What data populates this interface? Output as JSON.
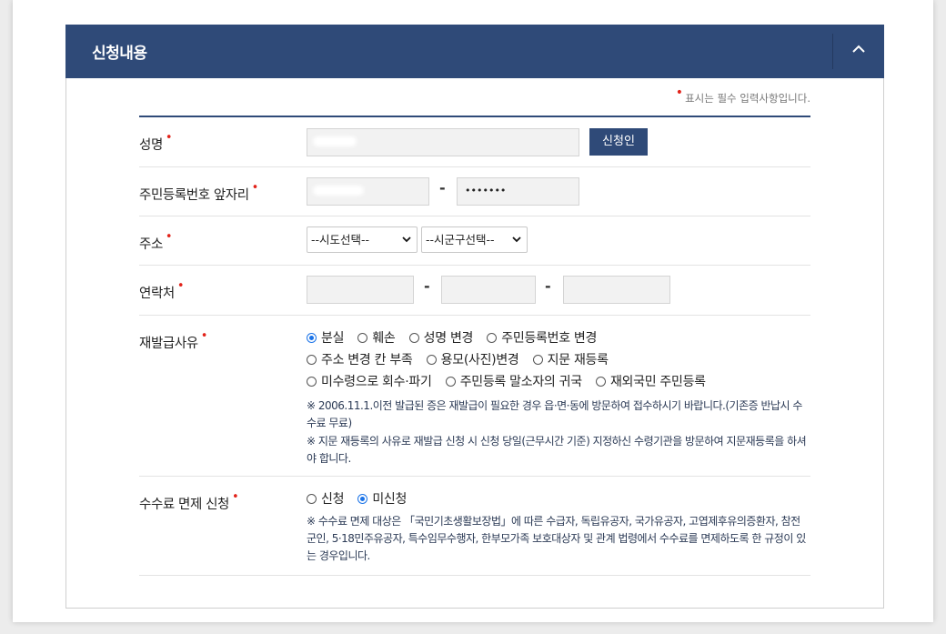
{
  "panel": {
    "title": "신청내용",
    "required_note": "표시는 필수 입력사항입니다."
  },
  "colors": {
    "header": "#2f4a78",
    "required_dot": "#e2231a",
    "radio_checked": "#1a73e8"
  },
  "fields": {
    "name": {
      "label": "성명",
      "button": "신청인"
    },
    "rrn": {
      "label": "주민등록번호 앞자리",
      "back_value": "•••••••"
    },
    "address": {
      "label": "주소",
      "sido": "--시도선택--",
      "sigungu": "--시군구선택--"
    },
    "contact": {
      "label": "연락처",
      "separator": "-"
    },
    "reason": {
      "label": "재발급사유",
      "options": [
        "분실",
        "훼손",
        "성명 변경",
        "주민등록번호 변경",
        "주소 변경 칸 부족",
        "용모(사진)변경",
        "지문 재등록",
        "미수령으로 회수·파기",
        "주민등록 말소자의 귀국",
        "재외국민 주민등록"
      ],
      "selected": "분실",
      "note1": "※ 2006.11.1.이전 발급된 증은 재발급이 필요한 경우 읍·면·동에 방문하여 접수하시기 바랍니다.(기존증 반납시 수수료 무료)",
      "note2": "※ 지문 재등록의 사유로 재발급 신청 시 신청 당일(근무시간 기준) 지정하신 수령기관을 방문하여 지문재등록을 하셔야 합니다."
    },
    "fee": {
      "label": "수수료 면제 신청",
      "options": [
        "신청",
        "미신청"
      ],
      "selected": "미신청",
      "note": "※ 수수료 면제 대상은 「국민기초생활보장법」에 따른 수급자, 독립유공자, 국가유공자, 고엽제후유의증환자, 참전군인, 5·18민주유공자, 특수임무수행자, 한부모가족 보호대상자 및 관계 법령에서 수수료를 면제하도록 한 규정이 있는 경우입니다."
    }
  }
}
